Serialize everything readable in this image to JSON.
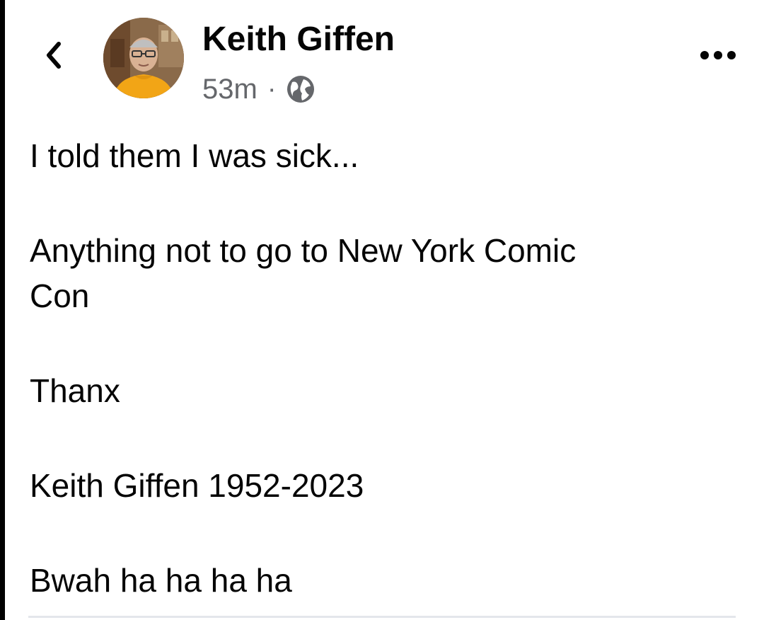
{
  "post": {
    "author": {
      "name": "Keith Giffen",
      "timestamp": "53m",
      "separator": "·",
      "audience_icon": "globe-icon"
    },
    "header_icons": {
      "back": "chevron-left-icon",
      "more": "more-horizontal-icon"
    },
    "body": {
      "line_1": "I told them I was sick...",
      "line_2a": "Anything not to go to New York Comic",
      "line_2b": "Con",
      "line_3": "Thanx",
      "line_4": "Keith Giffen 1952-2023",
      "line_5": "Bwah ha ha ha ha"
    }
  },
  "colors": {
    "text_primary": "#050505",
    "text_secondary": "#65676b",
    "avatar_shirt": "#f2a516"
  }
}
